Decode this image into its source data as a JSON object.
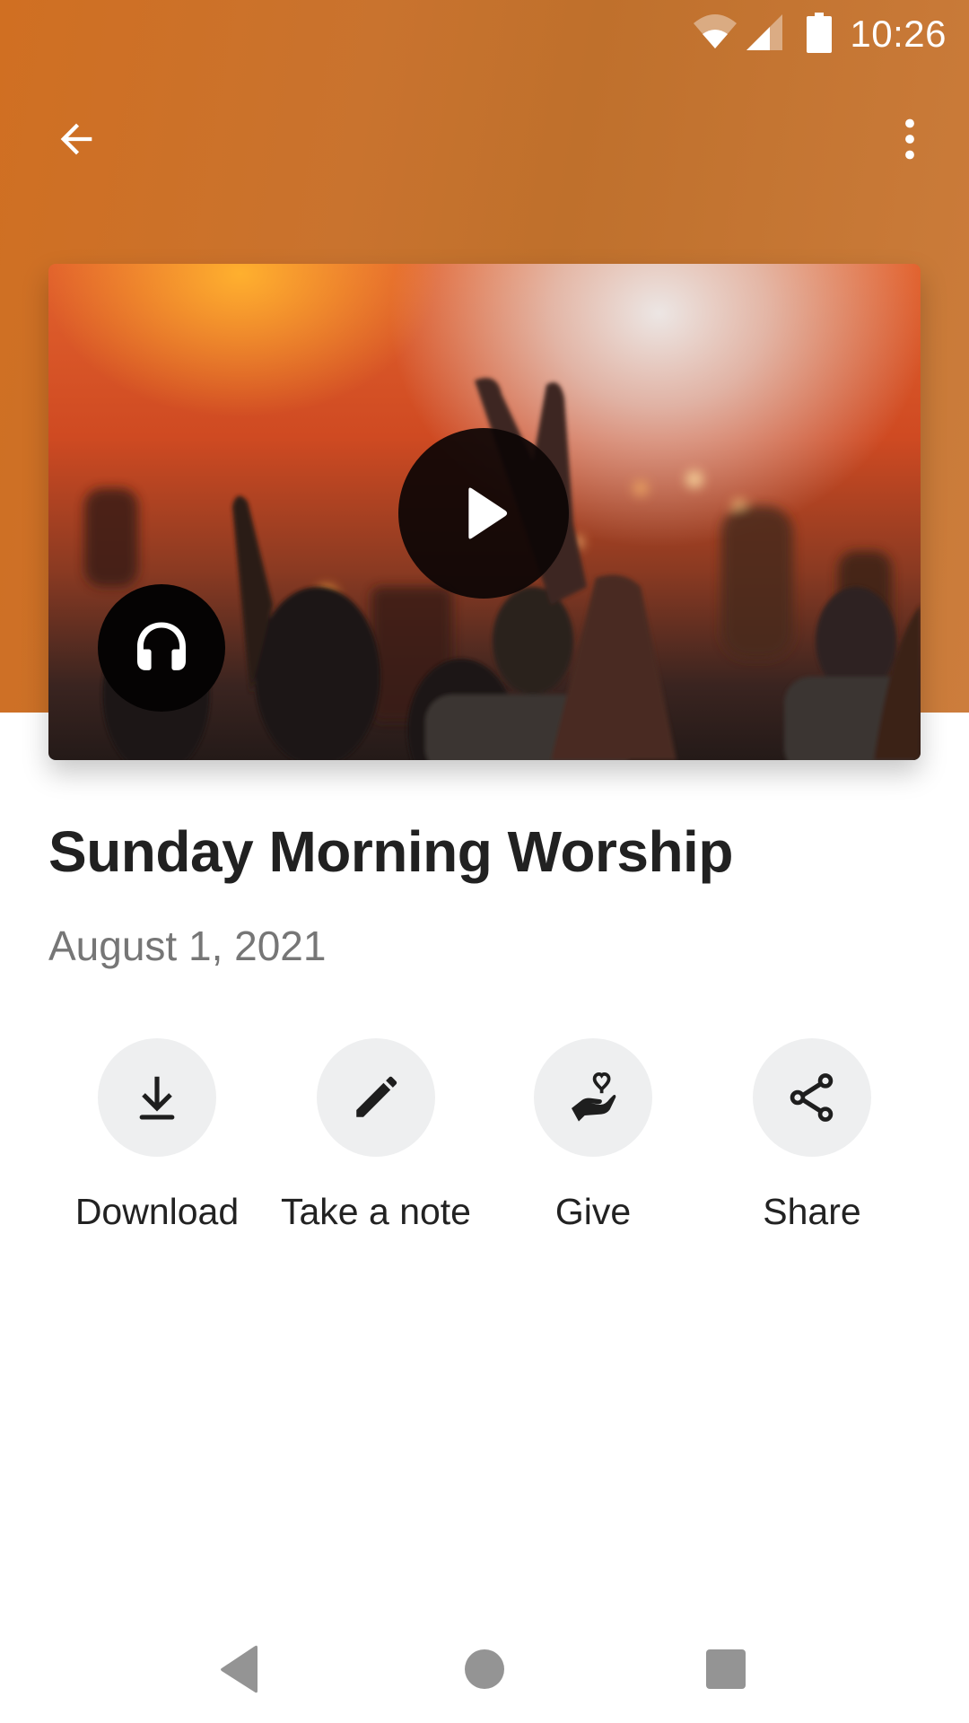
{
  "status_bar": {
    "time": "10:26",
    "icons": [
      "wifi-icon",
      "cell-signal-icon",
      "battery-icon"
    ]
  },
  "toolbar": {
    "back_icon": "arrow-back-icon",
    "more_icon": "more-vert-icon"
  },
  "media": {
    "play_icon": "play-icon",
    "audio_icon": "headphones-icon"
  },
  "sermon": {
    "title": "Sunday Morning Worship",
    "date": "August 1, 2021"
  },
  "actions": [
    {
      "label": "Download",
      "icon": "download-icon"
    },
    {
      "label": "Take a note",
      "icon": "pencil-icon"
    },
    {
      "label": "Give",
      "icon": "hand-heart-icon"
    },
    {
      "label": "Share",
      "icon": "share-icon"
    }
  ],
  "nav_bar": {
    "buttons": [
      "back",
      "home",
      "recents"
    ]
  },
  "colors": {
    "header": "#c9732e",
    "title_text": "#212121",
    "date_text": "#767676",
    "action_circle": "#eeeff0",
    "nav_icon": "#949494"
  }
}
